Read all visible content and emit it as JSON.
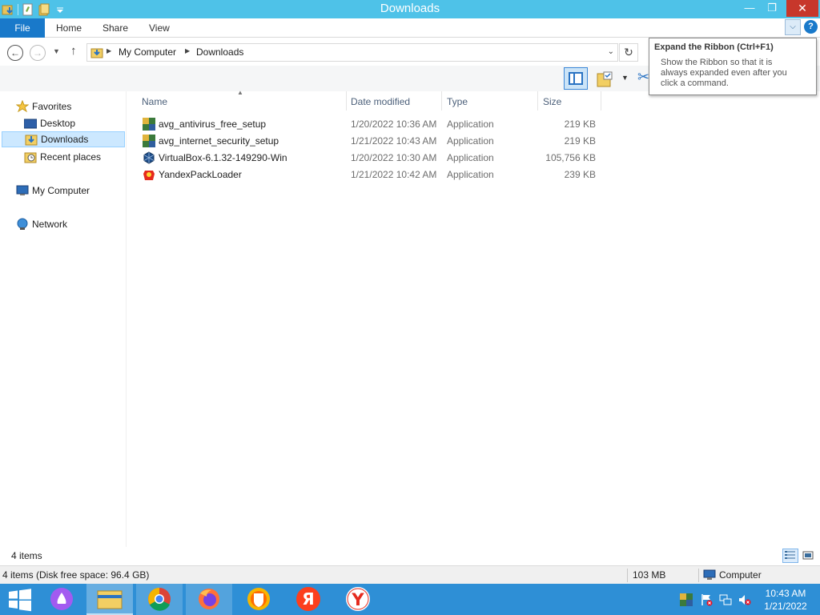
{
  "window": {
    "title": "Downloads",
    "minimize_glyph": "—",
    "maximize_glyph": "❐",
    "close_glyph": "✕"
  },
  "ribbon": {
    "tabs": [
      {
        "label": "File"
      },
      {
        "label": "Home"
      },
      {
        "label": "Share"
      },
      {
        "label": "View"
      }
    ],
    "expand_icon": "chevron-down-icon",
    "help_glyph": "?"
  },
  "tooltip": {
    "title": "Expand the Ribbon (Ctrl+F1)",
    "body_line1": "Show the Ribbon so that it is",
    "body_line2": "always expanded even after you",
    "body_line3": "click a command."
  },
  "address": {
    "crumbs": [
      "My Computer",
      "Downloads"
    ]
  },
  "nav_pane": {
    "favorites": "Favorites",
    "items": [
      {
        "label": "Desktop",
        "icon": "desktop-icon"
      },
      {
        "label": "Downloads",
        "icon": "downloads-folder-icon",
        "selected": true
      },
      {
        "label": "Recent places",
        "icon": "recent-places-icon"
      }
    ],
    "computer": "My Computer",
    "network": "Network"
  },
  "columns": {
    "name": "Name",
    "date": "Date modified",
    "type": "Type",
    "size": "Size"
  },
  "files": [
    {
      "name": "avg_antivirus_free_setup",
      "date": "1/20/2022 10:36 AM",
      "type": "Application",
      "size": "219 KB",
      "icon": "avg-icon"
    },
    {
      "name": "avg_internet_security_setup",
      "date": "1/21/2022 10:43 AM",
      "type": "Application",
      "size": "219 KB",
      "icon": "avg-icon"
    },
    {
      "name": "VirtualBox-6.1.32-149290-Win",
      "date": "1/20/2022 10:30 AM",
      "type": "Application",
      "size": "105,756 KB",
      "icon": "virtualbox-icon"
    },
    {
      "name": "YandexPackLoader",
      "date": "1/21/2022 10:42 AM",
      "type": "Application",
      "size": "239 KB",
      "icon": "yandex-pack-icon"
    }
  ],
  "count_bar": {
    "item_count": "4 items"
  },
  "status_bar": {
    "left": "4 items (Disk free space: 96.4 GB)",
    "size": "103 MB",
    "location": "Computer"
  },
  "taskbar": {
    "apps": [
      {
        "name": "start-button"
      },
      {
        "name": "alice-assistant"
      },
      {
        "name": "file-explorer",
        "state": "active"
      },
      {
        "name": "chrome",
        "state": "running"
      },
      {
        "name": "firefox",
        "state": "running"
      },
      {
        "name": "avast-secure-browser"
      },
      {
        "name": "yandex-ya"
      },
      {
        "name": "yandex-browser"
      }
    ],
    "clock_time": "10:43 AM",
    "clock_date": "1/21/2022"
  },
  "colors": {
    "titlebar": "#4ec2e8",
    "file_tab": "#1979ca",
    "close_button": "#c7372b",
    "selection": "#cce8ff",
    "taskbar": "#2e8fd6"
  }
}
